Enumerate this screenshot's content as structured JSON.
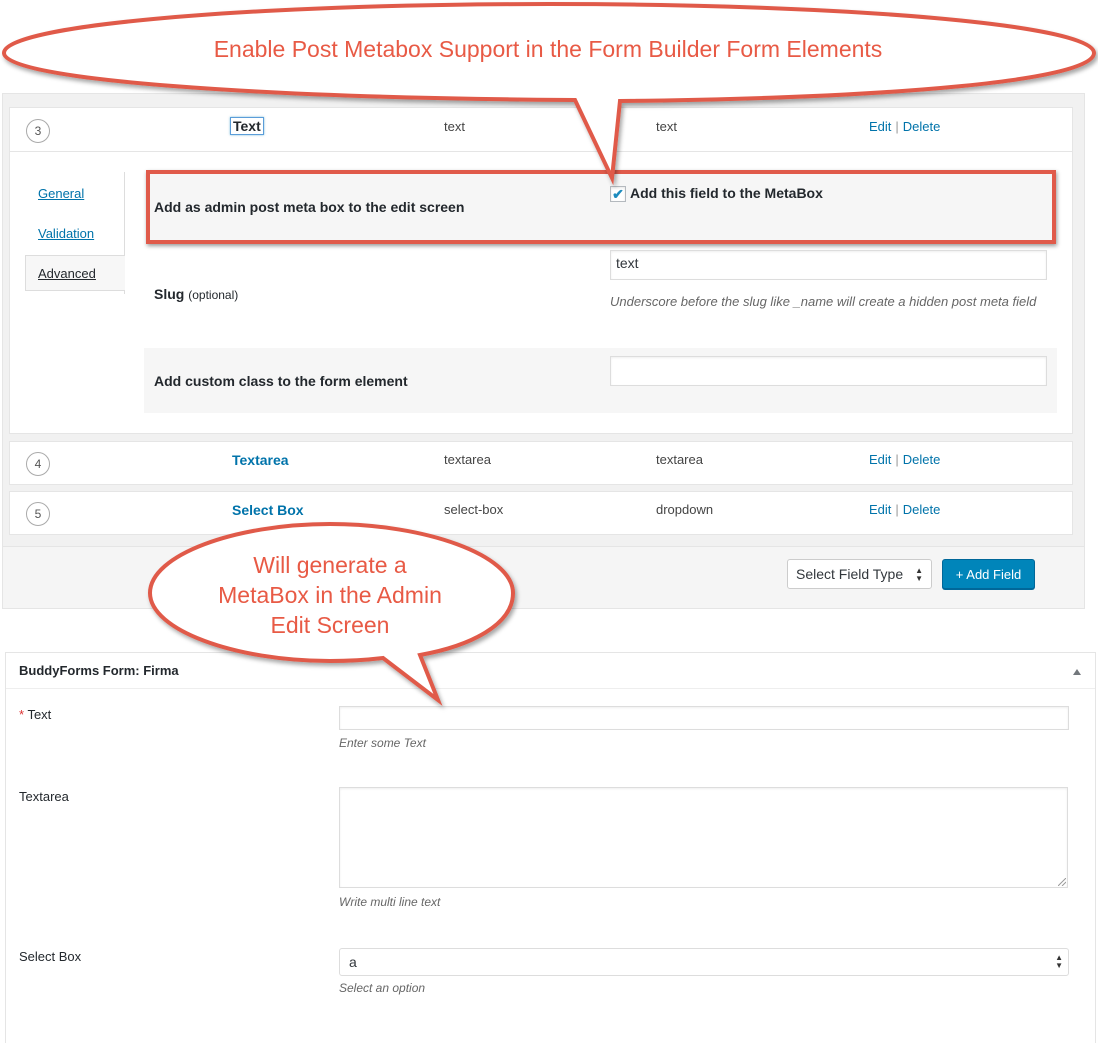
{
  "callouts": {
    "top": "Enable Post Metabox Support in the Form Builder Form Elements",
    "middle": [
      "Will generate a",
      "MetaBox in the Admin",
      "Edit Screen"
    ]
  },
  "builder": {
    "rows": [
      {
        "num": "3",
        "label": "Text",
        "slug": "text",
        "type": "text",
        "edit": "Edit",
        "sep": "|",
        "delete": "Delete"
      },
      {
        "num": "4",
        "label": "Textarea",
        "slug": "textarea",
        "type": "textarea",
        "edit": "Edit",
        "sep": "|",
        "delete": "Delete"
      },
      {
        "num": "5",
        "label": "Select Box",
        "slug": "select-box",
        "type": "dropdown",
        "edit": "Edit",
        "sep": "|",
        "delete": "Delete"
      }
    ],
    "tabs": {
      "general": "General",
      "validation": "Validation",
      "advanced": "Advanced"
    },
    "active_tab": "Advanced",
    "options": {
      "metabox_label": "Add as admin post meta box to the edit screen",
      "metabox_checkbox_label": "Add this field to the MetaBox",
      "metabox_checked": true,
      "slug_label": "Slug",
      "slug_optional": "(optional)",
      "slug_value": "text",
      "slug_desc": "Underscore before the slug like _name will create a hidden post meta field",
      "class_label": "Add custom class to the form element",
      "class_value": ""
    },
    "select_field_type": "Select Field Type",
    "add_field_button": "+ Add Field"
  },
  "metabox": {
    "title": "BuddyForms Form: Firma",
    "required_mark": "*",
    "fields": {
      "text_label": "Text",
      "text_desc": "Enter some Text",
      "textarea_label": "Textarea",
      "textarea_desc": "Write multi line text",
      "select_label": "Select Box",
      "select_value": "a",
      "select_desc": "Select an option"
    }
  },
  "colors": {
    "callout_text": "#e85a45",
    "callout_border": "#e05a4a",
    "link": "#0073aa",
    "primary_button": "#0085ba"
  },
  "icons": {
    "collapse": "triangle-up-icon",
    "checkbox": "checkmark-icon",
    "select_arrows": "updown-arrows-icon"
  }
}
